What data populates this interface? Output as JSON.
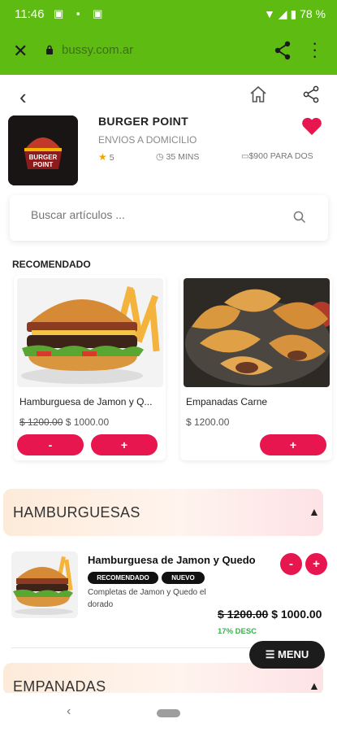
{
  "status_bar": {
    "time": "11:46",
    "battery": "78 %"
  },
  "browser": {
    "url": "bussy.com.ar"
  },
  "store": {
    "name": "BURGER POINT",
    "subtitle": "ENVIOS A DOMICILIO",
    "rating": "5",
    "delivery_time": "35 MINS",
    "price_for_two": "$900 PARA DOS",
    "logo_text_1": "BURGER",
    "logo_text_2": "POINT"
  },
  "search": {
    "placeholder": "Buscar artículos ..."
  },
  "recommended": {
    "title": "RECOMENDADO",
    "items": [
      {
        "name": "Hamburguesa de Jamon y Q...",
        "old_price": "$ 1200.00",
        "price": "$ 1000.00",
        "minus": "-",
        "plus": "+"
      },
      {
        "name": "Empanadas Carne",
        "price": "$ 1200.00",
        "plus": "+"
      }
    ]
  },
  "categories": [
    {
      "title": "HAMBURGUESAS",
      "products": [
        {
          "name": "Hamburguesa de Jamon y Quedo",
          "badges": [
            "RECOMENDADO",
            "NUEVO"
          ],
          "description": "Completas de Jamon y Quedo el dorado",
          "old_price": "$ 1200.00",
          "price": "$ 1000.00",
          "discount": "17% DESC",
          "minus": "-",
          "plus": "+"
        }
      ]
    },
    {
      "title": "EMPANADAS"
    }
  ],
  "menu_button": {
    "label": "MENU"
  },
  "colors": {
    "brand_green": "#5dbb12",
    "accent_red": "#e8164f",
    "discount_green": "#37b34a"
  }
}
